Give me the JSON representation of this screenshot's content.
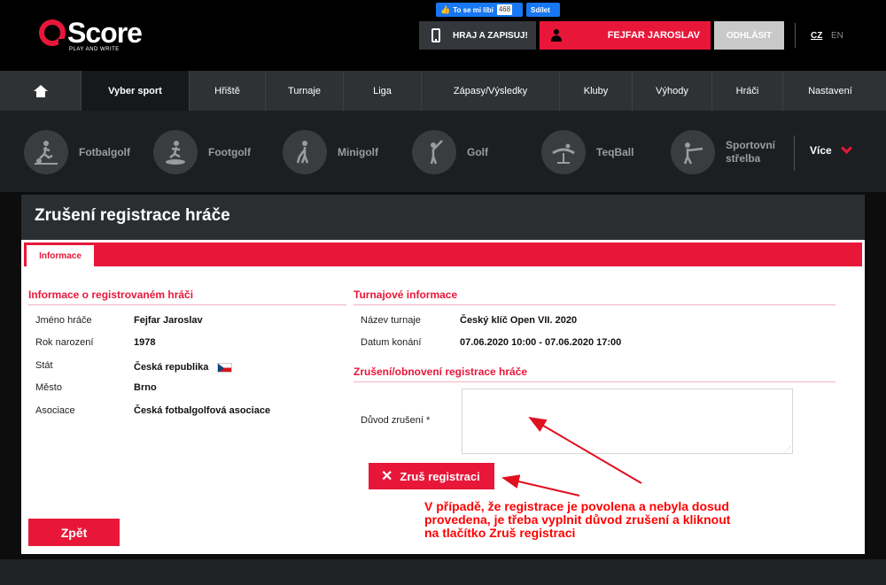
{
  "header": {
    "logo_text": "Score",
    "logo_sub": "PLAY AND WRITE",
    "fb_like_label": "To se mi líbí",
    "fb_like_count": "468",
    "fb_share_label": "Sdílet",
    "play_button": "HRAJ A ZAPISUJ!",
    "user_name": "FEJFAR JAROSLAV",
    "logout_button": "ODHLÁSIT",
    "lang_cz": "CZ",
    "lang_en": "EN"
  },
  "nav": {
    "items": [
      "Vyber sport",
      "Hřiště",
      "Turnaje",
      "Liga",
      "Zápasy/Výsledky",
      "Kluby",
      "Výhody",
      "Hráči",
      "Nastavení"
    ],
    "active": "Vyber sport"
  },
  "sports": {
    "items": [
      {
        "label": "Fotbalgolf",
        "icon": "footballgolf-icon"
      },
      {
        "label": "Footgolf",
        "icon": "footgolf-icon"
      },
      {
        "label": "Minigolf",
        "icon": "minigolf-icon"
      },
      {
        "label": "Golf",
        "icon": "golf-icon"
      },
      {
        "label": "TeqBall",
        "icon": "teqball-icon"
      },
      {
        "label_line1": "Sportovní",
        "label_line2": "střelba",
        "icon": "shooting-icon"
      }
    ],
    "more_label": "Více"
  },
  "page": {
    "title": "Zrušení registrace hráče",
    "tab_label": "Informace"
  },
  "player_info": {
    "section_title": "Informace o registrovaném hráči",
    "rows": [
      {
        "label": "Jméno hráče",
        "value": "Fejfar Jaroslav"
      },
      {
        "label": "Rok narození",
        "value": "1978"
      },
      {
        "label": "Stát",
        "value": "Česká republika"
      },
      {
        "label": "Město",
        "value": "Brno"
      },
      {
        "label": "Asociace",
        "value": "Česká fotbalgolfová asociace"
      }
    ]
  },
  "tournament_info": {
    "section_title": "Turnajové informace",
    "rows": [
      {
        "label": "Název turnaje",
        "value": "Český klíč Open VII. 2020"
      },
      {
        "label": "Datum konání",
        "value": "07.06.2020 10:00 - 07.06.2020 17:00"
      }
    ]
  },
  "cancel_section": {
    "section_title": "Zrušení/obnovení registrace hráče",
    "reason_label": "Důvod zrušení *",
    "reason_value": "",
    "cancel_button": "Zruš registraci"
  },
  "back_button": "Zpět",
  "annotation": {
    "line1": "V případě, že registrace je povolena a nebyla dosud",
    "line2": "provedena, je třeba vyplnit důvod zrušení a kliknout",
    "line3": "na tlačítko Zruš registraci"
  },
  "colors": {
    "accent": "#e8173a",
    "dark": "#2f3235",
    "annotation": "#ff0000"
  }
}
